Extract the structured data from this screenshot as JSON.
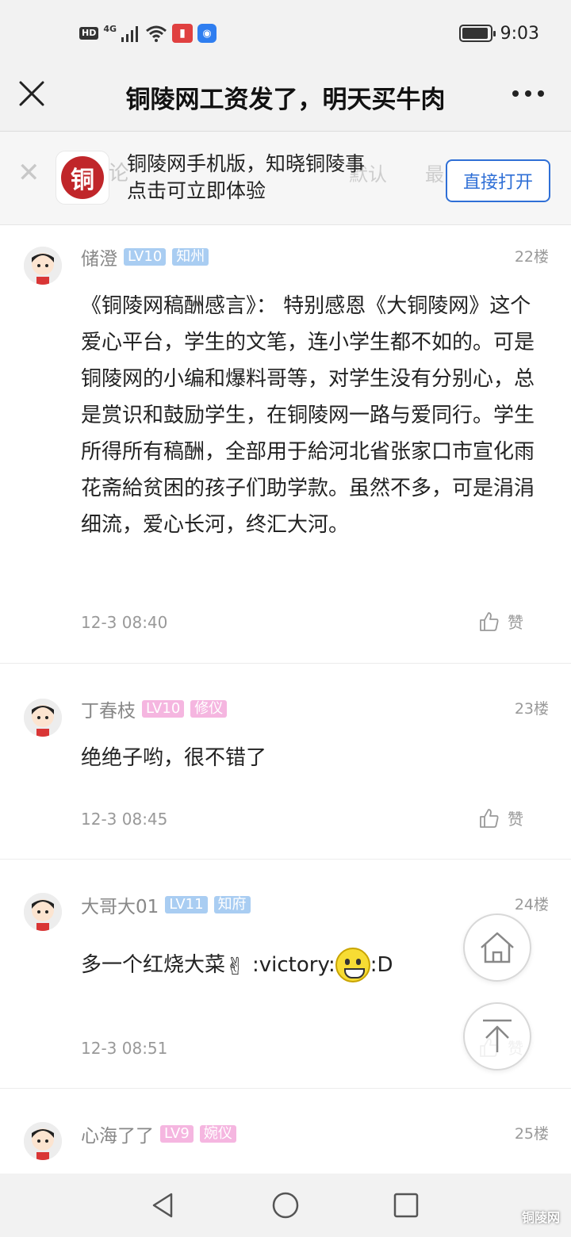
{
  "status_bar": {
    "hd": "HD",
    "signal_label": "4G",
    "battery_level": 0.95,
    "time": "9:03"
  },
  "header": {
    "title": "铜陵网工资发了，明天买牛肉",
    "close_icon": "close-icon",
    "more_icon": "more-icon"
  },
  "promo": {
    "ghost_left": [
      "全",
      "论"
    ],
    "ghost_right": [
      "默认",
      "最"
    ],
    "logo_char": "铜",
    "line1": "铜陵网手机版，知晓铜陵事",
    "line2": "点击可立即体验",
    "open_label": "直接打开"
  },
  "posts": [
    {
      "username": "储澄",
      "level": "LV10",
      "title_badge": "知州",
      "badge_color": "#a9cdf2",
      "floor": "22楼",
      "content": "《铜陵网稿酬感言》： 特别感恩《大铜陵网》这个爱心平台，学生的文笔，连小学生都不如的。可是铜陵网的小编和爆料哥等，对学生没有分别心，总是赏识和鼓励学生，在铜陵网一路与爱同行。学生所得所有稿酬，全部用于給河北省张家口市宣化雨花斋給贫困的孩子们助学款。虽然不多，可是涓涓细流，爱心长河，终汇大河。",
      "time": "12-3 08:40",
      "like_label": "赞"
    },
    {
      "username": "丁春枝",
      "level": "LV10",
      "title_badge": "修仪",
      "badge_color": "#f5b6e0",
      "floor": "23楼",
      "content": "绝绝子哟，很不错了",
      "time": "12-3 08:45",
      "like_label": "赞"
    },
    {
      "username": "大哥大01",
      "level": "LV11",
      "title_badge": "知府",
      "badge_color": "#a9cdf2",
      "floor": "24楼",
      "content_prefix": "多一个红烧大菜",
      "content_code1": ":victory:",
      "content_code2": ":D",
      "time": "12-3 08:51",
      "like_label": "赞"
    },
    {
      "username": "心海了了",
      "level": "LV9",
      "title_badge": "婉仪",
      "badge_color": "#f5b6e0",
      "floor": "25楼"
    }
  ],
  "floating": {
    "home_icon": "home-icon",
    "top_icon": "back-to-top-icon"
  },
  "nav": {
    "back_icon": "back-triangle-icon",
    "home_icon": "home-circle-icon",
    "recent_icon": "recent-square-icon",
    "watermark": "铜陵网"
  }
}
